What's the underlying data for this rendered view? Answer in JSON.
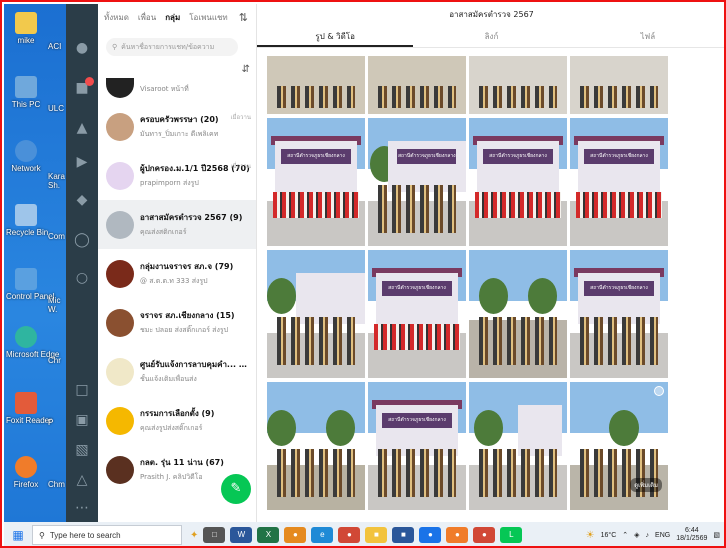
{
  "desktop": {
    "icons": [
      {
        "label": "mike",
        "color": "#f2c94c"
      },
      {
        "label": "This PC",
        "color": "#6fa8dc"
      },
      {
        "label": "Network",
        "color": "#4a90d9"
      },
      {
        "label": "Recycle Bin",
        "color": "#9ec5ea"
      },
      {
        "label": "Control Panel",
        "color": "#5aa0e0"
      },
      {
        "label": "Microsoft Edge",
        "color": "#2fb5a0"
      },
      {
        "label": "Foxit Reader",
        "color": "#e35b3a"
      },
      {
        "label": "Firefox",
        "color": "#f07c2a"
      }
    ],
    "side_labels": [
      "ACI",
      "ULC",
      "Kara Sh.",
      "Com",
      "Mic W.",
      "Chr",
      "P",
      "Chm"
    ]
  },
  "chatlist": {
    "tabs": [
      "ทั้งหมด",
      "เพื่อน",
      "กลุ่ม",
      "โอเพนแชท"
    ],
    "active_tab": "กลุ่ม",
    "search_placeholder": "ค้นหาชื่อรายการแชท/ข้อความ",
    "items": [
      {
        "name": "",
        "sub": "Visaroot หน้าที่",
        "time": "",
        "color": "#222"
      },
      {
        "name": "ครอบครัวพรรษา (20)",
        "sub": "มันทาร_ปิ่มเกาะ ดีเพลิเคท",
        "time": "เมื่อวาน",
        "color": "#c8a080"
      },
      {
        "name": "ผู้ปกครอง.ม.1/1 ปี2568 (70)",
        "sub": "prapimporn ส่งรูป",
        "time": "เมื่อวาน",
        "color": "#e5d5f0"
      },
      {
        "name": "อาสาสมัครตำรวจ 2567 (9)",
        "sub": "คุณส่งสติกเกอร์",
        "time": "",
        "color": "#b0b8c0"
      },
      {
        "name": "กลุ่มงานจราจร สภ.จ (79)",
        "sub": "@ ส.ต.ต.ท 333 ส่งรูป",
        "time": "",
        "color": "#7a2a1a"
      },
      {
        "name": "จราจร สภ.เชียงกลาง (15)",
        "sub": "ชมะ ปลอย ส่งสติ๊กเกอร์ ส่งรูป",
        "time": "",
        "color": "#8a5030"
      },
      {
        "name": "ศูนย์รับแจ้งการลาบคุมคำ... (34)",
        "sub": "ชั้นแจ้งเติมเพื่อนส่ง",
        "time": "",
        "color": "#f0e8c8"
      },
      {
        "name": "กรรมการเลือกตั้ง (9)",
        "sub": "คุณส่งรูปส่งสติ๊กเกอร์",
        "time": "",
        "color": "#f5b800"
      },
      {
        "name": "กลต. รุ่น 11 น่าน (67)",
        "sub": "Prasith J. คลิปวิดีโอ",
        "time": "",
        "color": "#5a3020"
      }
    ]
  },
  "album": {
    "title": "อาสาสมัครตำรวจ 2567",
    "tabs": [
      "รูป & วิดีโอ",
      "ลิงก์",
      "ไฟล์"
    ],
    "sign_text": "สถานีตำรวจภูธรเชียงกลาง",
    "more_label": "ดูเพิ่มเติม"
  },
  "taskbar": {
    "search_placeholder": "Type here to search",
    "weather": "16°C",
    "lang": "ENG",
    "time": "6:44",
    "date": "18/1/2569"
  }
}
